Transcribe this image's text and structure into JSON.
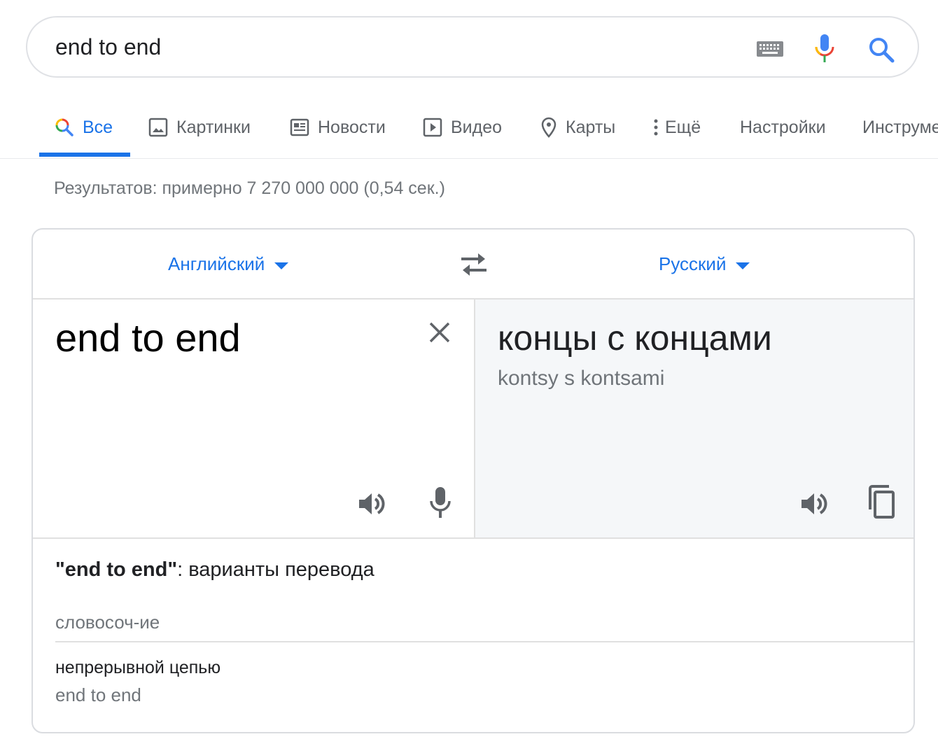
{
  "search": {
    "query": "end to end"
  },
  "tabs": [
    {
      "label": "Все",
      "icon": "search-icon",
      "active": true
    },
    {
      "label": "Картинки",
      "icon": "image-icon"
    },
    {
      "label": "Новости",
      "icon": "newspaper-icon"
    },
    {
      "label": "Видео",
      "icon": "play-icon"
    },
    {
      "label": "Карты",
      "icon": "map-pin-icon"
    },
    {
      "label": "Ещё",
      "icon": "more-vert-icon"
    },
    {
      "label": "Настройки"
    },
    {
      "label": "Инструменты"
    }
  ],
  "results_stats": "Результатов: примерно 7 270 000 000 (0,54 сек.)",
  "translate": {
    "source_lang": "Английский",
    "target_lang": "Русский",
    "source_text": "end to end",
    "target_text": "концы с концами",
    "transliteration": "kontsy s kontsami",
    "variants_title_quoted": "\"end to end\"",
    "variants_title_rest": ": варианты перевода",
    "part_of_speech": "словосоч-ие",
    "variants": [
      {
        "translation": "непрерывной цепью",
        "source": "end to end"
      }
    ]
  },
  "colors": {
    "accent": "#1a73e8",
    "muted": "#70757a",
    "target_bg": "#f5f7f9",
    "border": "#dadce0"
  }
}
